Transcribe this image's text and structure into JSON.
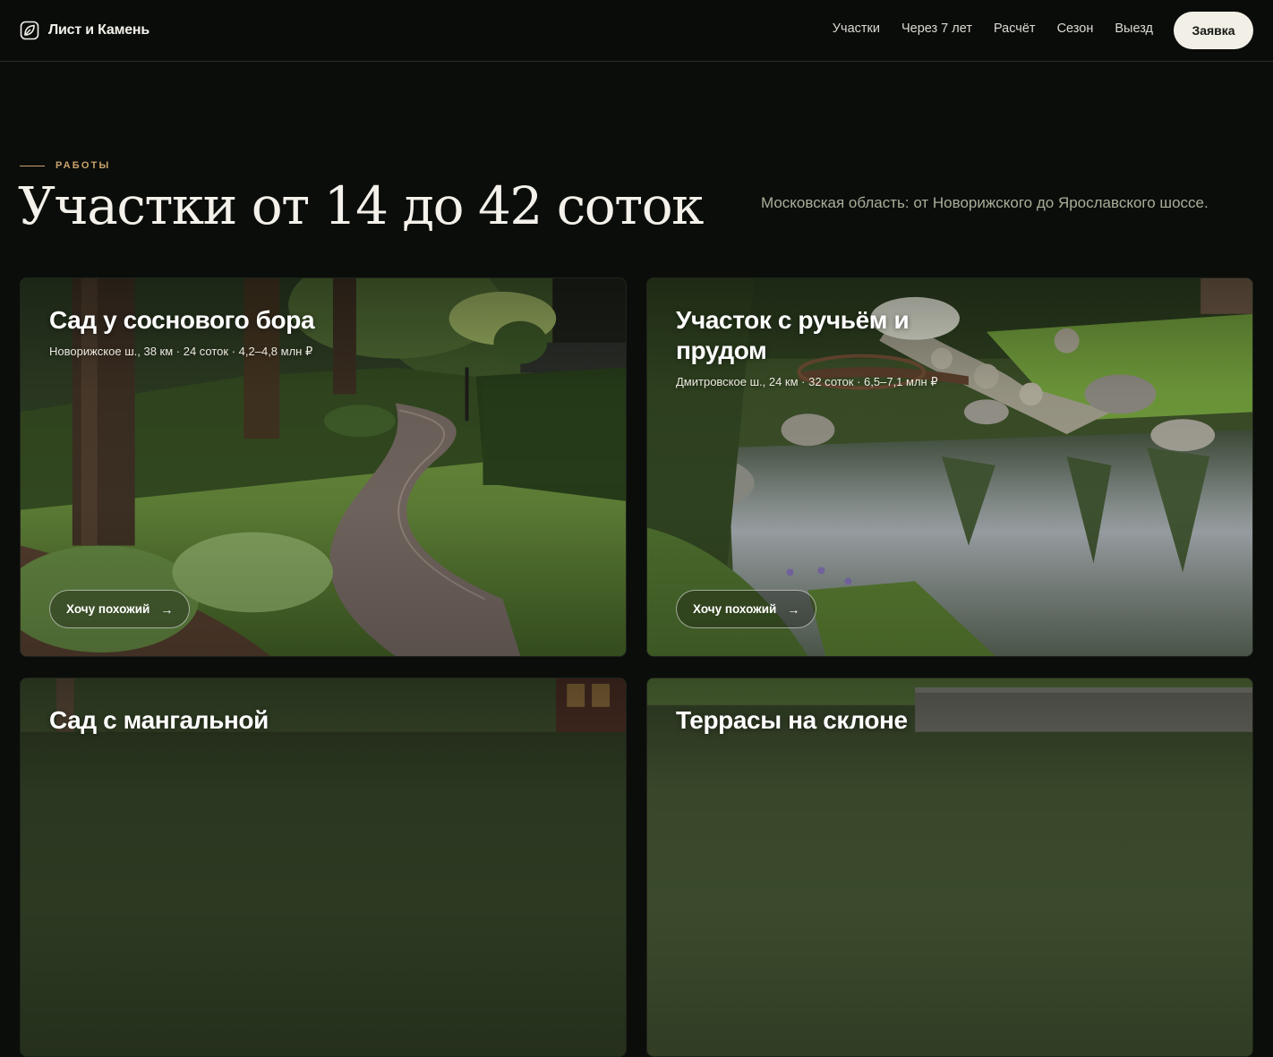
{
  "header": {
    "brand": "Лист и Камень",
    "nav": [
      "Участки",
      "Через 7 лет",
      "Расчёт",
      "Сезон",
      "Выезд"
    ],
    "cta": "Заявка"
  },
  "intro": {
    "eyebrow": "РАБОТЫ",
    "title": "Участки от 14 до 42 соток",
    "subtitle": "Московская область: от Новорижского до Ярославского шоссе."
  },
  "cards": [
    {
      "title": "Сад у соснового бора",
      "meta": "Новорижское ш., 38 км · 24 соток · 4,2–4,8 млн ₽",
      "button": "Хочу похожий"
    },
    {
      "title": "Участок с ручьём и прудом",
      "meta": "Дмитровское ш., 24 км · 32 соток · 6,5–7,1 млн ₽",
      "button": "Хочу похожий"
    },
    {
      "title": "Сад с мангальной"
    },
    {
      "title": "Террасы на склоне"
    }
  ],
  "colors": {
    "background": "#0b0d0b",
    "accent": "#c9a36b",
    "cta_bg": "#f2efe6",
    "subtitle": "#a7ae98"
  },
  "icons": {
    "brand": "leaf-icon",
    "button": "arrow-right-icon"
  }
}
